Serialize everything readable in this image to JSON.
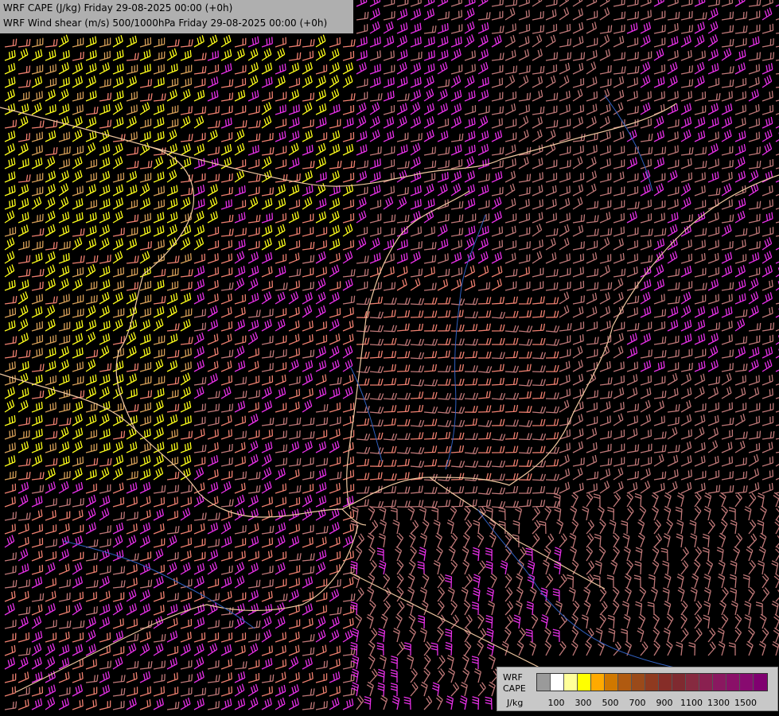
{
  "header": {
    "line1": "WRF CAPE (J/kg) Friday 29-08-2025 00:00 (+0h)",
    "line2": "WRF Wind shear (m/s) 500/1000hPa Friday 29-08-2025 00:00 (+0h)"
  },
  "legend": {
    "title_line1": "WRF",
    "title_line2": "CAPE",
    "unit": "J/kg",
    "colors": [
      "#9a9a9a",
      "#ffffff",
      "#ffff99",
      "#ffff00",
      "#ffaa00",
      "#d07800",
      "#b05a10",
      "#9a4a1a",
      "#8f3a20",
      "#862d28",
      "#7f2a30",
      "#862a40",
      "#8a2050",
      "#8a1860",
      "#8a1068",
      "#880a70",
      "#800070"
    ],
    "tick_labels": [
      "100",
      "300",
      "500",
      "700",
      "900",
      "1100",
      "1300",
      "1500"
    ]
  },
  "map": {
    "barb_colors": {
      "yellow": "#ffff1a",
      "tan": "#d8a058",
      "salmon": "#f08070",
      "mauve": "#c07878",
      "magenta": "#e830e8"
    },
    "border_color": "#f0c8a0",
    "river_color": "#3060c0"
  }
}
